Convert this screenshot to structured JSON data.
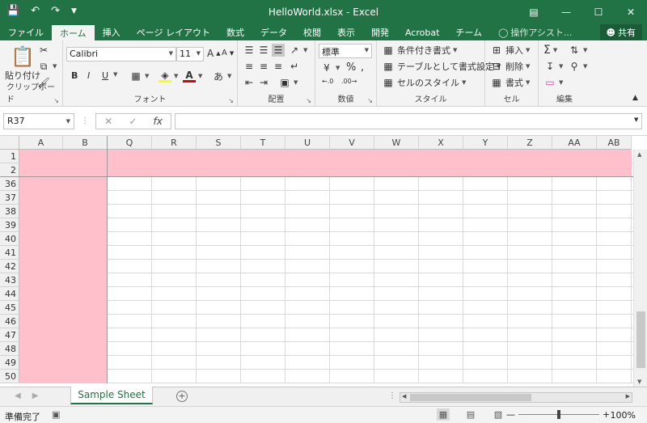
{
  "window": {
    "title": "HelloWorld.xlsx - Excel",
    "accent": "#217346"
  },
  "ribbon_tabs": [
    {
      "label": "ファイル"
    },
    {
      "label": "ホーム"
    },
    {
      "label": "挿入"
    },
    {
      "label": "ページ レイアウト"
    },
    {
      "label": "数式"
    },
    {
      "label": "データ"
    },
    {
      "label": "校閲"
    },
    {
      "label": "表示"
    },
    {
      "label": "開発"
    },
    {
      "label": "Acrobat"
    },
    {
      "label": "チーム"
    }
  ],
  "tell_me": "操作アシスト...",
  "share_label": "共有",
  "clipboard": {
    "paste": "貼り付け",
    "group": "クリップボード"
  },
  "font": {
    "name": "Calibri",
    "size": "11",
    "bold": "B",
    "italic": "I",
    "underline": "U",
    "grow": "A",
    "shrink": "A",
    "group": "フォント"
  },
  "alignment": {
    "group": "配置"
  },
  "number": {
    "format": "標準",
    "percent": "%",
    "comma": ",",
    "group": "数値"
  },
  "styles": {
    "conditional": "条件付き書式",
    "table": "テーブルとして書式設定",
    "cell": "セルのスタイル",
    "group": "スタイル"
  },
  "cells": {
    "insert": "挿入",
    "delete": "削除",
    "format": "書式",
    "group": "セル"
  },
  "editing": {
    "group": "編集"
  },
  "formula_bar": {
    "name_box": "R37",
    "fx": "fx",
    "value": ""
  },
  "columns": [
    "A",
    "B",
    "Q",
    "R",
    "S",
    "T",
    "U",
    "V",
    "W",
    "X",
    "Y",
    "Z",
    "AA",
    "AB"
  ],
  "rows": [
    "1",
    "2",
    "36",
    "37",
    "38",
    "39",
    "40",
    "41",
    "42",
    "43",
    "44",
    "45",
    "46",
    "47",
    "48",
    "49",
    "50"
  ],
  "fill_color": "#ffc0cb",
  "sheet_tab": "Sample Sheet",
  "status": {
    "ready": "準備完了",
    "zoom": "100%"
  }
}
